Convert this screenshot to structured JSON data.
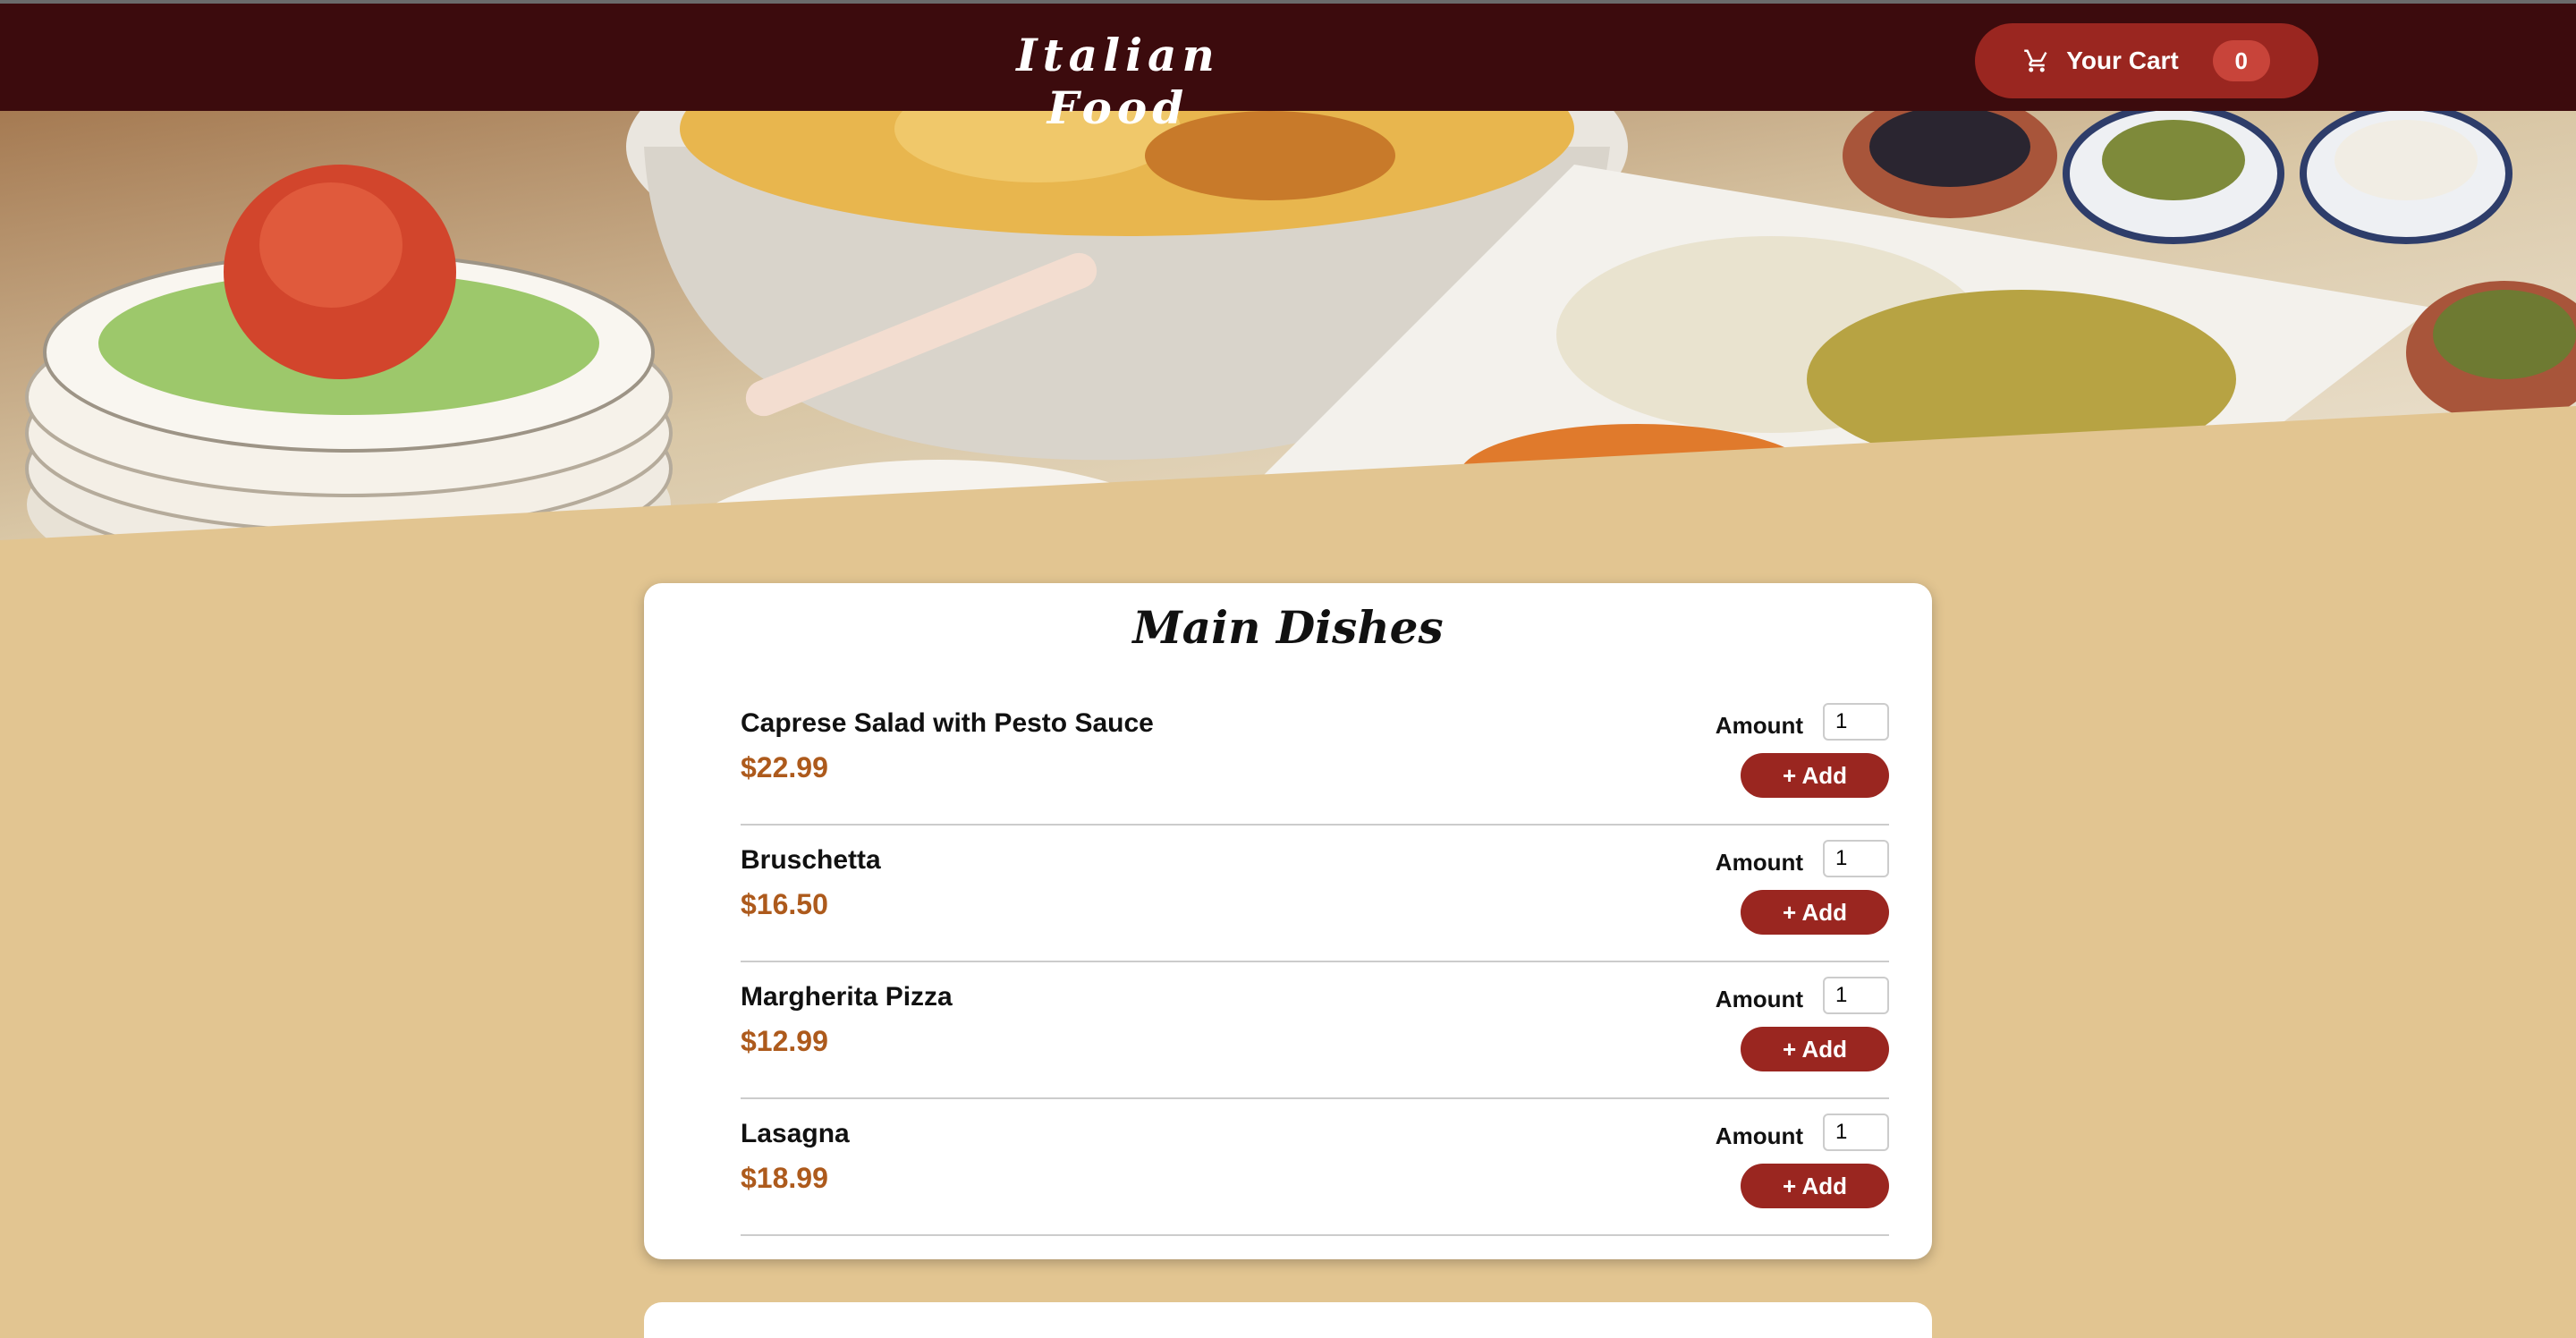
{
  "header": {
    "brand": "Italian Food",
    "cart_label": "Your Cart",
    "cart_count": "0",
    "cart_icon": "shopping-cart-icon"
  },
  "hero": {
    "image": "italian-dishes-photo"
  },
  "menu": {
    "title": "Main Dishes",
    "amount_label": "Amount",
    "add_label": "+ Add",
    "items": [
      {
        "name": "Caprese Salad with Pesto Sauce",
        "price": "$22.99",
        "amount": "1"
      },
      {
        "name": "Bruschetta",
        "price": "$16.50",
        "amount": "1"
      },
      {
        "name": "Margherita Pizza",
        "price": "$12.99",
        "amount": "1"
      },
      {
        "name": "Lasagna",
        "price": "$18.99",
        "amount": "1"
      }
    ]
  },
  "colors": {
    "header_bg": "#3c0b0d",
    "accent": "#9a2620",
    "page_bg": "#e2c591",
    "price": "#ad5a1c"
  }
}
